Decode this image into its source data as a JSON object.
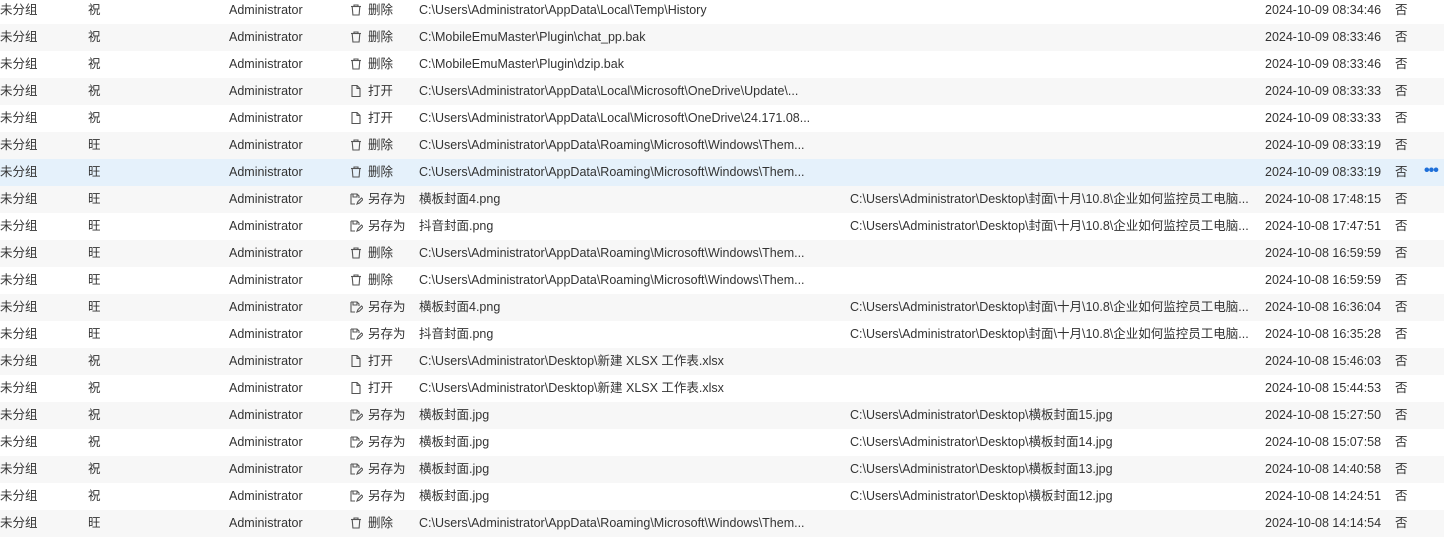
{
  "rows": [
    {
      "group": "未分组",
      "host": "祝",
      "user": "Administrator",
      "op_icon": "trash-icon",
      "op": "删除",
      "file": "C:\\Users\\Administrator\\AppData\\Local\\Temp\\History",
      "dest": "",
      "time": "2024-10-09 08:34:46",
      "flag": "否"
    },
    {
      "group": "未分组",
      "host": "祝",
      "user": "Administrator",
      "op_icon": "trash-icon",
      "op": "删除",
      "file": "C:\\MobileEmuMaster\\Plugin\\chat_pp.bak",
      "dest": "",
      "time": "2024-10-09 08:33:46",
      "flag": "否"
    },
    {
      "group": "未分组",
      "host": "祝",
      "user": "Administrator",
      "op_icon": "trash-icon",
      "op": "删除",
      "file": "C:\\MobileEmuMaster\\Plugin\\dzip.bak",
      "dest": "",
      "time": "2024-10-09 08:33:46",
      "flag": "否"
    },
    {
      "group": "未分组",
      "host": "祝",
      "user": "Administrator",
      "op_icon": "document-icon",
      "op": "打开",
      "file": "C:\\Users\\Administrator\\AppData\\Local\\Microsoft\\OneDrive\\Update\\...",
      "dest": "",
      "time": "2024-10-09 08:33:33",
      "flag": "否"
    },
    {
      "group": "未分组",
      "host": "祝",
      "user": "Administrator",
      "op_icon": "document-icon",
      "op": "打开",
      "file": "C:\\Users\\Administrator\\AppData\\Local\\Microsoft\\OneDrive\\24.171.08...",
      "dest": "",
      "time": "2024-10-09 08:33:33",
      "flag": "否"
    },
    {
      "group": "未分组",
      "host": "旺",
      "user": "Administrator",
      "op_icon": "trash-icon",
      "op": "删除",
      "file": "C:\\Users\\Administrator\\AppData\\Roaming\\Microsoft\\Windows\\Them...",
      "dest": "",
      "time": "2024-10-09 08:33:19",
      "flag": "否"
    },
    {
      "group": "未分组",
      "host": "旺",
      "user": "Administrator",
      "op_icon": "trash-icon",
      "op": "删除",
      "file": "C:\\Users\\Administrator\\AppData\\Roaming\\Microsoft\\Windows\\Them...",
      "dest": "",
      "time": "2024-10-09 08:33:19",
      "flag": "否",
      "more": "•••"
    },
    {
      "group": "未分组",
      "host": "旺",
      "user": "Administrator",
      "op_icon": "save-as-icon",
      "op": "另存为",
      "file": "横板封面4.png",
      "dest": "C:\\Users\\Administrator\\Desktop\\封面\\十月\\10.8\\企业如何监控员工电脑...",
      "time": "2024-10-08 17:48:15",
      "flag": "否"
    },
    {
      "group": "未分组",
      "host": "旺",
      "user": "Administrator",
      "op_icon": "save-as-icon",
      "op": "另存为",
      "file": "抖音封面.png",
      "dest": "C:\\Users\\Administrator\\Desktop\\封面\\十月\\10.8\\企业如何监控员工电脑...",
      "time": "2024-10-08 17:47:51",
      "flag": "否"
    },
    {
      "group": "未分组",
      "host": "旺",
      "user": "Administrator",
      "op_icon": "trash-icon",
      "op": "删除",
      "file": "C:\\Users\\Administrator\\AppData\\Roaming\\Microsoft\\Windows\\Them...",
      "dest": "",
      "time": "2024-10-08 16:59:59",
      "flag": "否"
    },
    {
      "group": "未分组",
      "host": "旺",
      "user": "Administrator",
      "op_icon": "trash-icon",
      "op": "删除",
      "file": "C:\\Users\\Administrator\\AppData\\Roaming\\Microsoft\\Windows\\Them...",
      "dest": "",
      "time": "2024-10-08 16:59:59",
      "flag": "否"
    },
    {
      "group": "未分组",
      "host": "旺",
      "user": "Administrator",
      "op_icon": "save-as-icon",
      "op": "另存为",
      "file": "横板封面4.png",
      "dest": "C:\\Users\\Administrator\\Desktop\\封面\\十月\\10.8\\企业如何监控员工电脑...",
      "time": "2024-10-08 16:36:04",
      "flag": "否"
    },
    {
      "group": "未分组",
      "host": "旺",
      "user": "Administrator",
      "op_icon": "save-as-icon",
      "op": "另存为",
      "file": "抖音封面.png",
      "dest": "C:\\Users\\Administrator\\Desktop\\封面\\十月\\10.8\\企业如何监控员工电脑...",
      "time": "2024-10-08 16:35:28",
      "flag": "否"
    },
    {
      "group": "未分组",
      "host": "祝",
      "user": "Administrator",
      "op_icon": "document-icon",
      "op": "打开",
      "file": "C:\\Users\\Administrator\\Desktop\\新建 XLSX 工作表.xlsx",
      "dest": "",
      "time": "2024-10-08 15:46:03",
      "flag": "否"
    },
    {
      "group": "未分组",
      "host": "祝",
      "user": "Administrator",
      "op_icon": "document-icon",
      "op": "打开",
      "file": "C:\\Users\\Administrator\\Desktop\\新建 XLSX 工作表.xlsx",
      "dest": "",
      "time": "2024-10-08 15:44:53",
      "flag": "否"
    },
    {
      "group": "未分组",
      "host": "祝",
      "user": "Administrator",
      "op_icon": "save-as-icon",
      "op": "另存为",
      "file": "横板封面.jpg",
      "dest": "C:\\Users\\Administrator\\Desktop\\横板封面15.jpg",
      "time": "2024-10-08 15:27:50",
      "flag": "否"
    },
    {
      "group": "未分组",
      "host": "祝",
      "user": "Administrator",
      "op_icon": "save-as-icon",
      "op": "另存为",
      "file": "横板封面.jpg",
      "dest": "C:\\Users\\Administrator\\Desktop\\横板封面14.jpg",
      "time": "2024-10-08 15:07:58",
      "flag": "否"
    },
    {
      "group": "未分组",
      "host": "祝",
      "user": "Administrator",
      "op_icon": "save-as-icon",
      "op": "另存为",
      "file": "横板封面.jpg",
      "dest": "C:\\Users\\Administrator\\Desktop\\横板封面13.jpg",
      "time": "2024-10-08 14:40:58",
      "flag": "否"
    },
    {
      "group": "未分组",
      "host": "祝",
      "user": "Administrator",
      "op_icon": "save-as-icon",
      "op": "另存为",
      "file": "横板封面.jpg",
      "dest": "C:\\Users\\Administrator\\Desktop\\横板封面12.jpg",
      "time": "2024-10-08 14:24:51",
      "flag": "否"
    },
    {
      "group": "未分组",
      "host": "旺",
      "user": "Administrator",
      "op_icon": "trash-icon",
      "op": "删除",
      "file": "C:\\Users\\Administrator\\AppData\\Roaming\\Microsoft\\Windows\\Them...",
      "dest": "",
      "time": "2024-10-08 14:14:54",
      "flag": "否"
    }
  ],
  "selected_row": 6,
  "colors": {
    "text": "#333333",
    "selected_row_bg": "#e5f1fb",
    "stripe_bg": "#f7f7f7",
    "more_icon": "#1e6fd9"
  }
}
